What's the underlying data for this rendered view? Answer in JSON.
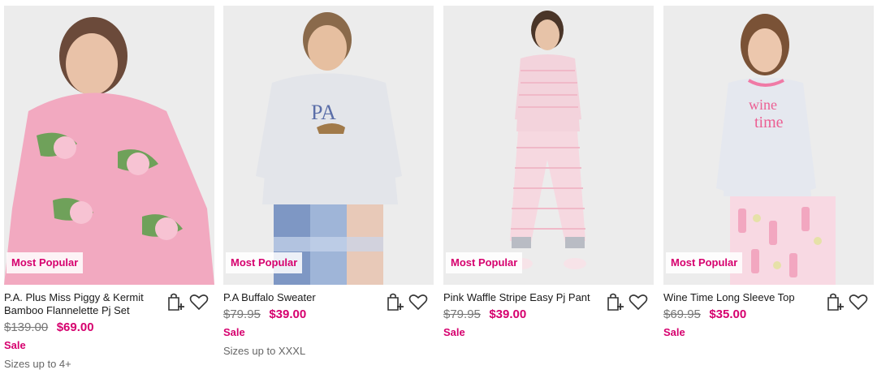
{
  "colors": {
    "brand_pink": "#d6006e",
    "image_bg": "#ececec"
  },
  "products": [
    {
      "badge": "Most Popular",
      "title": "P.A. Plus Miss Piggy & Kermit Bamboo Flannelette Pj Set",
      "was_price": "$139.00",
      "now_price": "$69.00",
      "sale_label": "Sale",
      "sizes": "Sizes up to 4+",
      "icons": [
        "add-to-bag-icon",
        "heart-icon"
      ]
    },
    {
      "badge": "Most Popular",
      "title": "P.A Buffalo Sweater",
      "was_price": "$79.95",
      "now_price": "$39.00",
      "sale_label": "Sale",
      "sizes": "Sizes up to XXXL",
      "icons": [
        "add-to-bag-icon",
        "heart-icon"
      ]
    },
    {
      "badge": "Most Popular",
      "title": "Pink Waffle Stripe Easy Pj Pant",
      "was_price": "$79.95",
      "now_price": "$39.00",
      "sale_label": "Sale",
      "sizes": "",
      "icons": [
        "add-to-bag-icon",
        "heart-icon"
      ]
    },
    {
      "badge": "Most Popular",
      "title": "Wine Time Long Sleeve Top",
      "was_price": "$69.95",
      "now_price": "$35.00",
      "sale_label": "Sale",
      "sizes": "",
      "icons": [
        "add-to-bag-icon",
        "heart-icon"
      ]
    }
  ]
}
